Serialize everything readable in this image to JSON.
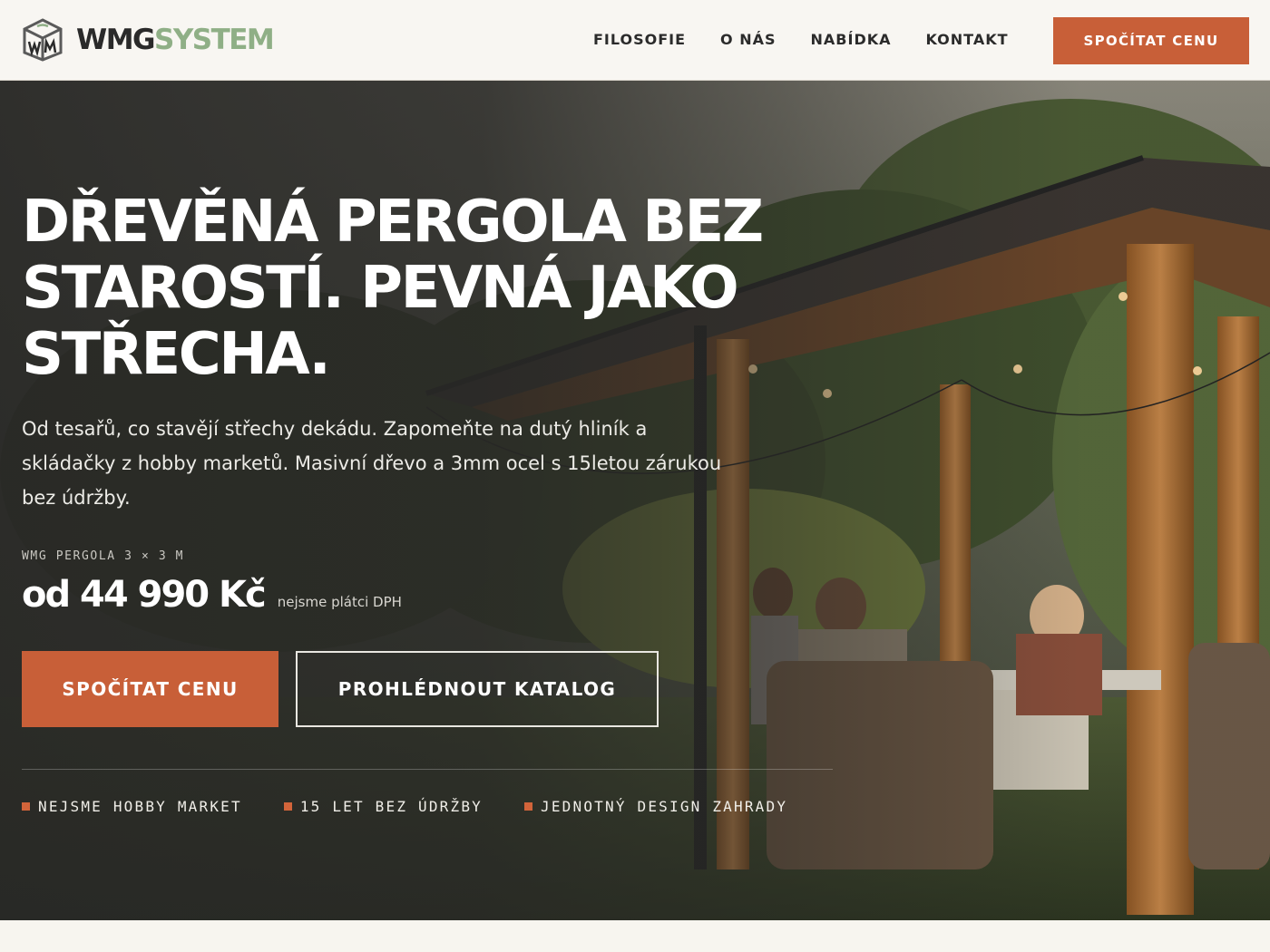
{
  "brand": {
    "name_part1": "WMG",
    "name_part2": "SYSTEM",
    "accent_color": "#c85f38",
    "logo_green": "#8faf86"
  },
  "nav": {
    "items": [
      {
        "label": "FILOSOFIE"
      },
      {
        "label": "O NÁS"
      },
      {
        "label": "NABÍDKA"
      },
      {
        "label": "KONTAKT"
      }
    ],
    "cta_label": "SPOČÍTAT CENU"
  },
  "hero": {
    "headline": "DŘEVĚNÁ PERGOLA BEZ STAROSTÍ. PEVNÁ JAKO STŘECHA.",
    "lead": "Od tesařů, co stavějí střechy dekádu. Zapomeňte na dutý hliník a skládačky z hobby marketů. Masivní dřevo a 3mm ocel s 15letou zárukou bez údržby.",
    "product_caption": "WMG PERGOLA 3 × 3 M",
    "price": "od 44 990 Kč",
    "vat_note": "nejsme plátci DPH",
    "primary_button": "SPOČÍTAT CENU",
    "secondary_button": "PROHLÉDNOUT KATALOG",
    "features": [
      {
        "label": "NEJSME HOBBY MARKET"
      },
      {
        "label": "15 LET BEZ ÚDRŽBY"
      },
      {
        "label": "JEDNOTNÝ DESIGN ZAHRADY"
      }
    ],
    "background_image": "photo-pergola-family-dinner-garden"
  }
}
